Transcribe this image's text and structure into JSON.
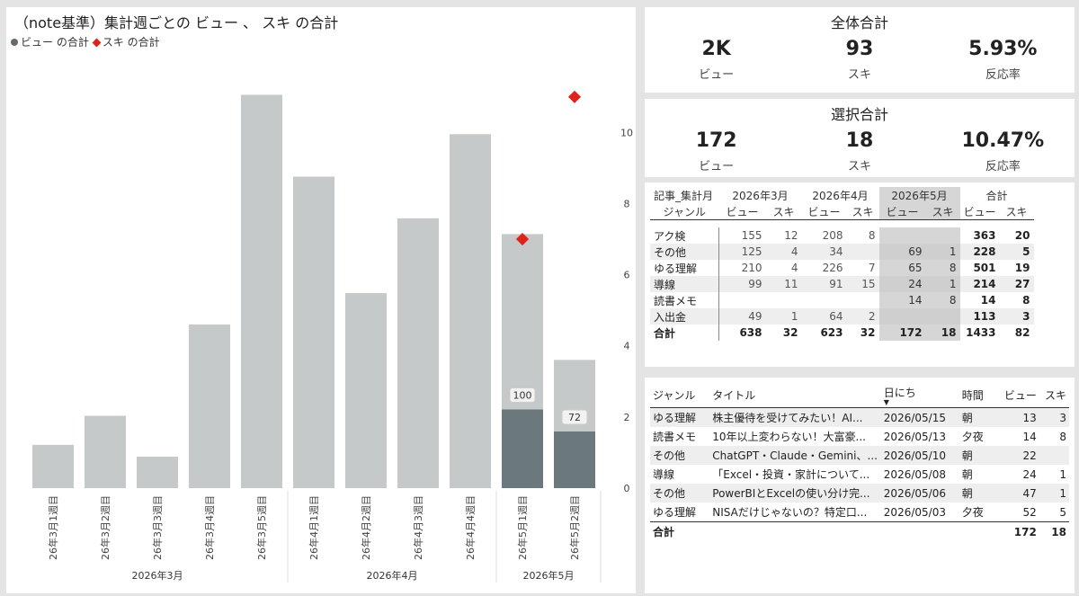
{
  "chart": {
    "title": "（note基準）集計週ごとの ビュー 、 スキ の合計",
    "legend": {
      "views": "ビュー の合計",
      "likes": "スキ の合計"
    },
    "colors": {
      "bar": "#c6c9c9",
      "bar_highlight": "#6b787c",
      "marker": "#e0221b"
    }
  },
  "chart_data": {
    "type": "bar",
    "categories": [
      "26年3月1週目",
      "26年3月2週目",
      "26年3月3週目",
      "26年3月4週目",
      "26年3月5週目",
      "26年4月1週目",
      "26年4月2週目",
      "26年4月3週目",
      "26年4月4週目",
      "26年5月1週目",
      "26年5月2週目"
    ],
    "month_groups": [
      {
        "label": "2026年3月",
        "count": 5
      },
      {
        "label": "2026年4月",
        "count": 4
      },
      {
        "label": "2026年5月",
        "count": 2
      }
    ],
    "series": [
      {
        "name": "ビュー の合計",
        "type": "bar",
        "values": [
          55,
          92,
          40,
          208,
          500,
          396,
          248,
          343,
          450,
          323,
          163
        ],
        "highlighted": [
          null,
          null,
          null,
          null,
          null,
          null,
          null,
          null,
          null,
          100,
          72
        ],
        "highlight_labels": [
          "100",
          "72"
        ]
      },
      {
        "name": "スキ の合計",
        "type": "scatter",
        "values": [
          null,
          null,
          null,
          null,
          null,
          null,
          null,
          null,
          null,
          7,
          11
        ]
      }
    ],
    "y_right_ticks": [
      "0",
      "2",
      "4",
      "6",
      "8",
      "10"
    ],
    "y_right_range": [
      0,
      11.5
    ]
  },
  "kpi_total": {
    "title": "全体合計",
    "items": [
      {
        "value": "2K",
        "label": "ビュー"
      },
      {
        "value": "93",
        "label": "スキ"
      },
      {
        "value": "5.93%",
        "label": "反応率"
      }
    ]
  },
  "kpi_selected": {
    "title": "選択合計",
    "items": [
      {
        "value": "172",
        "label": "ビュー"
      },
      {
        "value": "18",
        "label": "スキ"
      },
      {
        "value": "10.47%",
        "label": "反応率"
      }
    ]
  },
  "matrix": {
    "corner_top": "記事_集計月",
    "corner_bottom": "ジャンル",
    "months": [
      "2026年3月",
      "2026年4月",
      "2026年5月"
    ],
    "total_label": "合計",
    "sub_headers": [
      "ビュー",
      "スキ"
    ],
    "rows": [
      {
        "genre": "アク検",
        "cells": [
          "155",
          "12",
          "208",
          "8",
          "",
          "",
          "363",
          "20"
        ]
      },
      {
        "genre": "その他",
        "cells": [
          "125",
          "4",
          "34",
          "",
          "69",
          "1",
          "228",
          "5"
        ]
      },
      {
        "genre": "ゆる理解",
        "cells": [
          "210",
          "4",
          "226",
          "7",
          "65",
          "8",
          "501",
          "19"
        ]
      },
      {
        "genre": "導線",
        "cells": [
          "99",
          "11",
          "91",
          "15",
          "24",
          "1",
          "214",
          "27"
        ]
      },
      {
        "genre": "読書メモ",
        "cells": [
          "",
          "",
          "",
          "",
          "14",
          "8",
          "14",
          "8"
        ]
      },
      {
        "genre": "入出金",
        "cells": [
          "49",
          "1",
          "64",
          "2",
          "",
          "",
          "113",
          "3"
        ]
      }
    ],
    "total_row": {
      "genre": "合計",
      "cells": [
        "638",
        "32",
        "623",
        "32",
        "172",
        "18",
        "1433",
        "82"
      ]
    }
  },
  "detail": {
    "headers": [
      "ジャンル",
      "タイトル",
      "日にち",
      "時間",
      "ビュー",
      "スキ"
    ],
    "rows": [
      {
        "genre": "ゆる理解",
        "title": "株主優待を受けてみたい！AI...",
        "date": "2026/05/15",
        "time": "朝",
        "views": "13",
        "likes": "3"
      },
      {
        "genre": "読書メモ",
        "title": "10年以上変わらない！大富豪...",
        "date": "2026/05/13",
        "time": "夕夜",
        "views": "14",
        "likes": "8"
      },
      {
        "genre": "その他",
        "title": "ChatGPT・Claude・Gemini、...",
        "date": "2026/05/10",
        "time": "朝",
        "views": "22",
        "likes": ""
      },
      {
        "genre": "導線",
        "title": "「Excel・投資・家計について...",
        "date": "2026/05/08",
        "time": "朝",
        "views": "24",
        "likes": "1"
      },
      {
        "genre": "その他",
        "title": "PowerBIとExcelの使い分け完...",
        "date": "2026/05/06",
        "time": "朝",
        "views": "47",
        "likes": "1"
      },
      {
        "genre": "ゆる理解",
        "title": "NISAだけじゃないの？特定口...",
        "date": "2026/05/03",
        "time": "夕夜",
        "views": "52",
        "likes": "5"
      }
    ],
    "total": {
      "label": "合計",
      "views": "172",
      "likes": "18"
    }
  }
}
